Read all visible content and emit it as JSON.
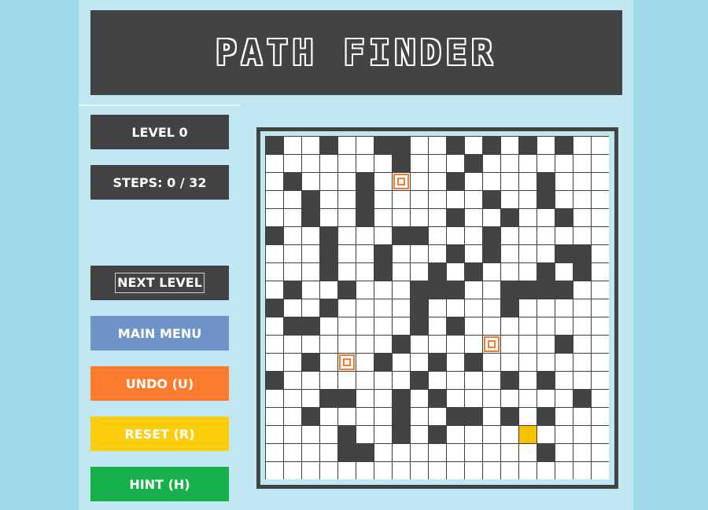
{
  "title": "PATH FINDER",
  "level_label": "LEVEL 0",
  "steps_label": "STEPS: 0 / 32",
  "buttons": {
    "next_level": "NEXT LEVEL",
    "main_menu": "MAIN MENU",
    "undo": "UNDO (U)",
    "reset": "RESET (R)",
    "hint": "HINT (H)"
  },
  "colors": {
    "background": "#9fd9ea",
    "panel": "#bfe6f1",
    "dark": "#434343",
    "main_menu": "#6f95c8",
    "undo": "#fd7b2e",
    "reset": "#fbcd0c",
    "hint": "#16b14a",
    "target_marker": "#f07c2e",
    "player": "#f5c400"
  },
  "grid": {
    "rows": 19,
    "cols": 19,
    "legend": {
      "0": "empty",
      "1": "wall",
      "2": "target",
      "3": "player"
    },
    "cells": [
      "1001001100101010100",
      "0000000100010000000",
      "0100010200100001000",
      "0010010000001001000",
      "0010010000100100100",
      "1001000110001000000",
      "0001001000101000110",
      "0001001001010001010",
      "0100100011100111100",
      "1001000010000100000",
      "0110000010100000000",
      "0000000100002000100",
      "0010201001010000000",
      "1000000010000101000",
      "0001100101000000010",
      "0010000100110101000",
      "0000100101000030000",
      "0000110000000001000",
      "0000000000000000000"
    ]
  }
}
